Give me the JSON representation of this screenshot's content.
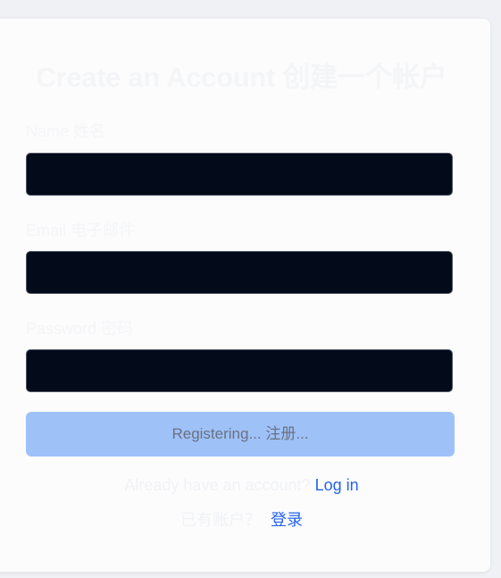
{
  "form": {
    "title": "Create an Account  创建一个帐户",
    "name_label": "Name  姓名",
    "name_value": "",
    "email_label": "Email  电子邮件",
    "email_value": "",
    "password_label": "Password  密码",
    "password_value": "",
    "submit_label": "Registering...  注册..."
  },
  "footer": {
    "prompt_en": "Already have an account?",
    "login_en": "Log in",
    "prompt_zh": "已有账户？",
    "login_zh": "登录"
  },
  "colors": {
    "input_background": "#030a1a",
    "submit_disabled": "#9ec1f8",
    "link": "#2563eb"
  }
}
